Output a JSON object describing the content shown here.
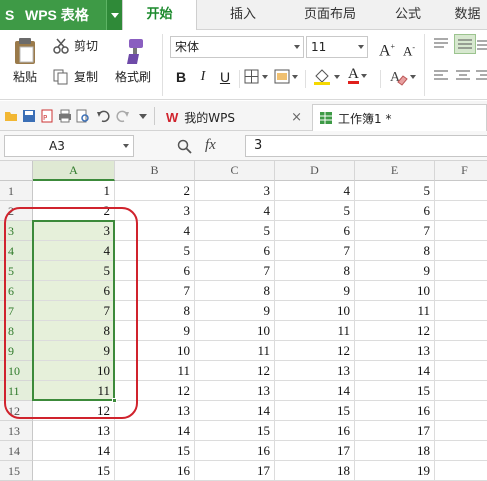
{
  "app": {
    "title": "WPS 表格",
    "logo_letter": "S"
  },
  "menu_tabs": [
    "开始",
    "插入",
    "页面布局",
    "公式",
    "数据"
  ],
  "ribbon": {
    "paste": "粘贴",
    "cut": "剪切",
    "copy": "复制",
    "format_painter": "格式刷",
    "font_name": "宋体",
    "font_size": "11",
    "bold": "B",
    "italic": "I",
    "underline": "U",
    "grow_font": "A",
    "shrink_font": "A",
    "font_color_letter": "A"
  },
  "doc_tabs": [
    {
      "label": "我的WPS",
      "active": false
    },
    {
      "label": "工作簿1 *",
      "active": true
    }
  ],
  "formula_bar": {
    "cell_ref": "A3",
    "fx": "fx",
    "value": "3"
  },
  "columns": [
    "A",
    "B",
    "C",
    "D",
    "E",
    "F"
  ],
  "rows": [
    {
      "num": "1",
      "cells": [
        "1",
        "2",
        "3",
        "4",
        "5",
        ""
      ]
    },
    {
      "num": "2",
      "cells": [
        "2",
        "3",
        "4",
        "5",
        "6",
        ""
      ]
    },
    {
      "num": "3",
      "cells": [
        "3",
        "4",
        "5",
        "6",
        "7",
        ""
      ]
    },
    {
      "num": "4",
      "cells": [
        "4",
        "5",
        "6",
        "7",
        "8",
        ""
      ]
    },
    {
      "num": "5",
      "cells": [
        "5",
        "6",
        "7",
        "8",
        "9",
        ""
      ]
    },
    {
      "num": "6",
      "cells": [
        "6",
        "7",
        "8",
        "9",
        "10",
        ""
      ]
    },
    {
      "num": "7",
      "cells": [
        "7",
        "8",
        "9",
        "10",
        "11",
        ""
      ]
    },
    {
      "num": "8",
      "cells": [
        "8",
        "9",
        "10",
        "11",
        "12",
        ""
      ]
    },
    {
      "num": "9",
      "cells": [
        "9",
        "10",
        "11",
        "12",
        "13",
        ""
      ]
    },
    {
      "num": "10",
      "cells": [
        "10",
        "11",
        "12",
        "13",
        "14",
        ""
      ]
    },
    {
      "num": "11",
      "cells": [
        "11",
        "12",
        "13",
        "14",
        "15",
        ""
      ]
    },
    {
      "num": "12",
      "cells": [
        "12",
        "13",
        "14",
        "15",
        "16",
        ""
      ]
    },
    {
      "num": "13",
      "cells": [
        "13",
        "14",
        "15",
        "16",
        "17",
        ""
      ]
    },
    {
      "num": "14",
      "cells": [
        "14",
        "15",
        "16",
        "17",
        "18",
        ""
      ]
    },
    {
      "num": "15",
      "cells": [
        "15",
        "16",
        "17",
        "18",
        "19",
        ""
      ]
    }
  ],
  "selection": {
    "column": "A",
    "first_row": "3",
    "last_row": "11"
  },
  "colors": {
    "brand": "#3e9a46",
    "selection": "#3c8a3a",
    "selection_fill": "#e6f0da",
    "annotation": "#d0232d"
  }
}
